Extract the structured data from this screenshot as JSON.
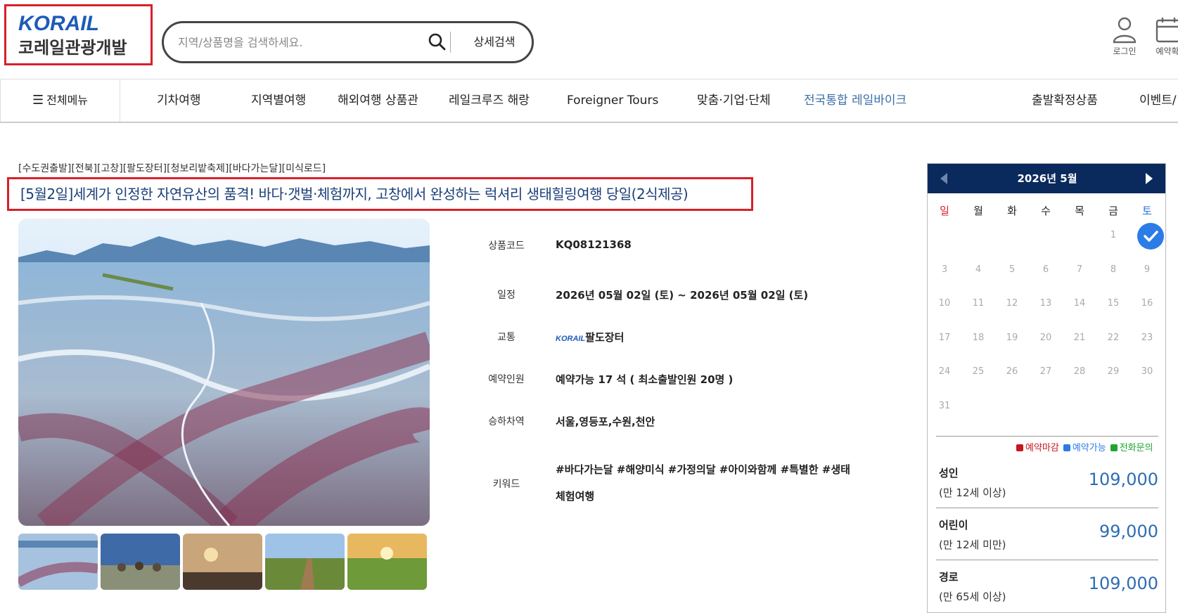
{
  "header": {
    "logo_top": "KORAIL",
    "logo_bottom": "코레일관광개발",
    "search_placeholder": "지역/상품명을 검색하세요.",
    "detail_search": "상세검색",
    "login": "로그인",
    "reservation": "예약확"
  },
  "gnb": {
    "all_menu": "전체메뉴",
    "items": [
      "기차여행",
      "지역별여행",
      "해외여행 상품관",
      "레일크루즈 해랑",
      "Foreigner Tours",
      "맞춤·기업·단체",
      "전국통합 레일바이크",
      "출발확정상품",
      "이벤트/"
    ]
  },
  "product": {
    "tags": "[수도권출발][전북][고창][팔도장터][청보리밭축제][바다가는달][미식로드]",
    "title": "[5월2일]세계가 인정한 자연유산의 품격! 바다·갯벌·체험까지, 고창에서 완성하는 럭셔리 생태힐링여행 당일(2식제공)",
    "info": {
      "code_label": "상품코드",
      "code": "KQ08121368",
      "schedule_label": "일정",
      "schedule": "2026년 05월 02일 (토) ~ 2026년 05월 02일 (토)",
      "transport_label": "교통",
      "transport_logo": "KORAIL",
      "transport": "팔도장터",
      "capacity_label": "예약인원",
      "capacity": "예약가능 17 석 ( 최소출발인원  20명 )",
      "station_label": "승하차역",
      "station": "서울,영등포,수원,천안",
      "keyword_label": "키워드",
      "keyword": "#바다가는달 #해양미식 #가정의달 #아이와함께 #특별한 #생태체험여행"
    }
  },
  "calendar": {
    "title": "2026년 5월",
    "dow": [
      "일",
      "월",
      "화",
      "수",
      "목",
      "금",
      "토"
    ],
    "weeks": [
      [
        "",
        "",
        "",
        "",
        "",
        "1",
        "2"
      ],
      [
        "3",
        "4",
        "5",
        "6",
        "7",
        "8",
        "9"
      ],
      [
        "10",
        "11",
        "12",
        "13",
        "14",
        "15",
        "16"
      ],
      [
        "17",
        "18",
        "19",
        "20",
        "21",
        "22",
        "23"
      ],
      [
        "24",
        "25",
        "26",
        "27",
        "28",
        "29",
        "30"
      ],
      [
        "31",
        "",
        "",
        "",
        "",
        "",
        ""
      ]
    ],
    "selected_day": "2",
    "legend": [
      {
        "label": "예약마감",
        "color": "#c8161d"
      },
      {
        "label": "예약가능",
        "color": "#2b7ce6"
      },
      {
        "label": "전화문의",
        "color": "#1fa531"
      }
    ],
    "prices": [
      {
        "type": "성인",
        "cond": "(만 12세 이상)",
        "price": "109,000"
      },
      {
        "type": "어린이",
        "cond": "(만 12세 미만)",
        "price": "99,000"
      },
      {
        "type": "경로",
        "cond": "(만 65세 이상)",
        "price": "109,000"
      }
    ]
  },
  "colors": {
    "brand_red": "#d8202a",
    "navy": "#0a2a5e",
    "price_blue": "#2e6db2"
  }
}
